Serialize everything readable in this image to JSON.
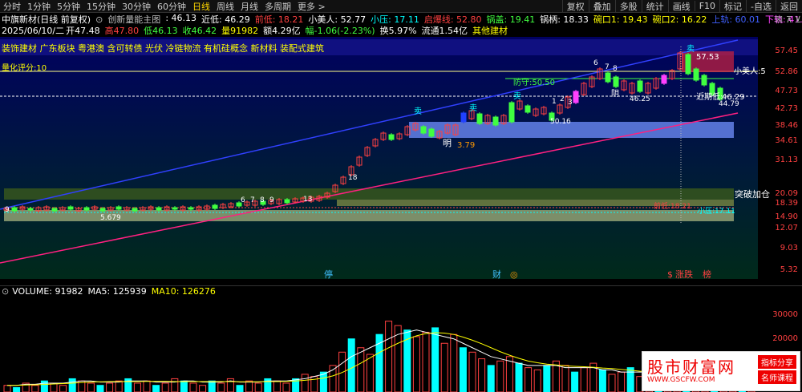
{
  "toolbar": {
    "periods": [
      "分时",
      "1分钟",
      "5分钟",
      "15分钟",
      "30分钟",
      "60分钟",
      "日线",
      "周线",
      "月线",
      "多周期",
      "更多 >"
    ],
    "active": "日线",
    "buttons": [
      "复权",
      "叠加",
      "多股",
      "统计",
      "画线",
      "F10",
      "标记",
      "-自选",
      "返回"
    ]
  },
  "info1": {
    "stock": "中旗新材(日线 前复权)",
    "indicator": "创新量能主图",
    "items": [
      {
        "text": ": 46.13",
        "color": "#ffffff"
      },
      {
        "text": "近低: 46.29",
        "color": "#ffffff"
      },
      {
        "text": "前低: 18.21",
        "color": "#ff4040"
      },
      {
        "text": "小美人: 52.77",
        "color": "#ffffff"
      },
      {
        "text": "小压: 17.11",
        "color": "#00ffff"
      },
      {
        "text": "启爆线: 52.80",
        "color": "#ff4040"
      },
      {
        "text": "锅盖: 19.41",
        "color": "#40ff40"
      },
      {
        "text": "锅柄: 18.33",
        "color": "#ffffff"
      },
      {
        "text": "碗口1: 19.43",
        "color": "#ffff00"
      },
      {
        "text": "碗口2: 16.22",
        "color": "#ffff00"
      },
      {
        "text": "上轨: 60.01",
        "color": "#4060ff"
      },
      {
        "text": "下轨: 41.73",
        "color": "#ff40ff"
      }
    ]
  },
  "info2": {
    "date": "2025/06/10/二",
    "open_label": "开",
    "open": "47.48",
    "high_label": "高",
    "high": "47.80",
    "low_label": "低",
    "low": "46.13",
    "close_label": "收",
    "close": "46.42",
    "vol_label": "量",
    "vol": "91982",
    "amt_label": "额",
    "amt": "4.29亿",
    "chg_label": "幅",
    "chg": "-1.06(-2.23%)",
    "turn_label": "换",
    "turn": "5.97%",
    "float_label": "流通",
    "float": "1.54亿",
    "other": "其他建材"
  },
  "plates": "装饰建材 广东板块 粤港澳 含可转债 光伏 冷链物流 有机硅概念 新材料 装配式建筑",
  "score": "量化评分:10",
  "price_axis": [
    "57.45",
    "52.86",
    "47.73",
    "42.73",
    "38.46",
    "34.61",
    "31.13",
    "20.09",
    "18.39",
    "14.90",
    "12.07",
    "9.03",
    "5.32"
  ],
  "chart_labels": {
    "defend": "防守:50.50",
    "near_low": "近期低:",
    "near_low_val": "46.29",
    "sell1": "卖",
    "sell2": "卖",
    "sell3": "卖",
    "buy_mark": "明",
    "yin": "阴",
    "fang": "防",
    "breakout": "突破加仓",
    "top_price": "57.53",
    "p_5679": "5.679",
    "p_3879": "3.79",
    "p_5056": "50.16",
    "p_4625": "46.25",
    "p_4479": "44.79",
    "small_beauty": "小美人:5",
    "front_low": "前低:18.21",
    "small_press": "小压:17.11",
    "seq1": [
      "6",
      "7",
      "8"
    ],
    "seq2": [
      "1",
      "2",
      "3"
    ],
    "seq3": [
      "18"
    ],
    "seq4": [
      "9",
      "6",
      "7",
      "8",
      "9"
    ],
    "seq5": [
      "13"
    ],
    "bottom_icons": [
      "停",
      "财",
      "◎",
      "$",
      "涨跌",
      "榜"
    ]
  },
  "volume": {
    "label": "VOLUME: 91982",
    "ma5": "MA5: 125939",
    "ma10": "MA10: 126276",
    "axis": [
      "30000",
      "20000",
      "10000"
    ]
  },
  "chart_data": {
    "type": "bar",
    "title": "VOLUME",
    "values": [
      3,
      2,
      4,
      3,
      5,
      4,
      3,
      6,
      5,
      4,
      3,
      4,
      5,
      6,
      4,
      5,
      3,
      4,
      6,
      5,
      4,
      3,
      5,
      4,
      6,
      3,
      5,
      4,
      6,
      5,
      4,
      6,
      8,
      7,
      9,
      12,
      18,
      24,
      20,
      17,
      26,
      32,
      30,
      28,
      25,
      27,
      29,
      22,
      26,
      20,
      18,
      15,
      12,
      14,
      16,
      13,
      11,
      10,
      12,
      14,
      12,
      9,
      11,
      13,
      10,
      8,
      9,
      11,
      7,
      9,
      6,
      8,
      7,
      6,
      5,
      8,
      7,
      6,
      5,
      7,
      6
    ],
    "colors_note": "red hollow = up, cyan filled = down",
    "ma5": [
      3,
      3,
      3.5,
      3.5,
      4,
      4,
      4,
      4.5,
      5,
      5,
      4.5,
      4.5,
      4.5,
      5,
      5,
      5,
      4.5,
      4.5,
      4.5,
      5,
      5,
      4.5,
      4.5,
      4.5,
      5,
      4.5,
      4.5,
      4.5,
      5,
      5,
      5,
      5.5,
      6,
      7,
      8,
      10,
      13,
      16,
      18,
      20,
      22,
      24,
      26,
      27,
      28,
      27,
      26,
      25,
      24,
      22,
      20,
      18,
      16,
      15,
      14,
      13,
      12,
      12,
      12,
      12,
      11,
      11,
      11,
      11,
      10,
      10,
      9,
      9,
      9,
      9,
      8,
      8,
      8,
      7,
      7,
      7,
      6,
      6,
      6,
      6,
      6
    ],
    "ylim": [
      0,
      38000
    ]
  },
  "watermark": {
    "title": "股市财富网",
    "url": "WWW.GSCFW.COM",
    "tag1": "指标分享",
    "tag2": "名师课程"
  }
}
